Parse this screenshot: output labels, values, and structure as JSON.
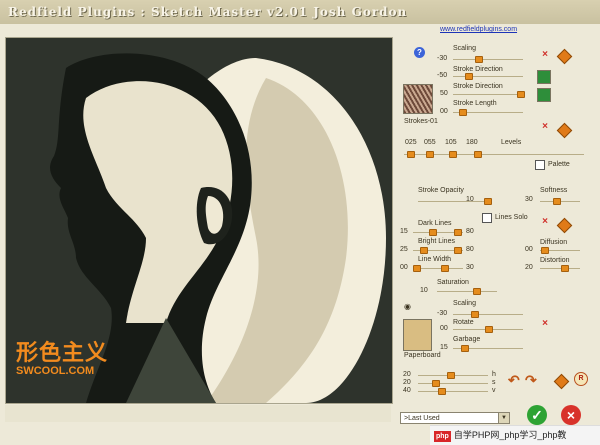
{
  "window": {
    "title": "Redfield Plugins : Sketch Master v2.01    Josh Gordon",
    "url": "www.redfieldplugins.com"
  },
  "preview": {
    "watermark_cn": "形色主义",
    "watermark_site": "SWCOOL.COM"
  },
  "panel": {
    "help_icon": "?",
    "scaling_label": "Scaling",
    "scaling_value": "-30",
    "stroke_direction_label": "Stroke Direction",
    "stroke_direction_value": "-50",
    "stroke_direction2_label": "Stroke Direction",
    "stroke_direction2_value": "50",
    "stroke_length_label": "Stroke Length",
    "stroke_length_value": "00",
    "strokes_preset": "Strokes-01",
    "levels_label": "Levels",
    "levels_values": [
      "025",
      "055",
      "105",
      "180"
    ],
    "palette_label": "Palette",
    "stroke_opacity_label": "Stroke Opacity",
    "stroke_opacity_value": "10",
    "softness_label": "Softness",
    "softness_value": "30",
    "dark_lines_label": "Dark Lines",
    "dark_lines_min": "15",
    "dark_lines_max": "80",
    "lines_solo_label": "Lines Solo",
    "bright_lines_label": "Bright Lines",
    "bright_lines_min": "25",
    "bright_lines_max": "80",
    "diffusion_label": "Diffusion",
    "diffusion_value": "00",
    "line_width_label": "Line Width",
    "line_width_min": "00",
    "line_width_max": "30",
    "distortion_label": "Distortion",
    "distortion_value": "20",
    "saturation_label": "Saturation",
    "saturation_value": "10",
    "paper_scaling_label": "Scaling",
    "paper_scaling_value": "-30",
    "rotate_label": "Rotate",
    "rotate_value": "00",
    "garbage_label": "Garbage",
    "garbage_value": "15",
    "paperboard_label": "Paperboard",
    "h_value": "20",
    "s_value": "20",
    "v_value": "40",
    "h_label": "h",
    "s_label": "s",
    "v_label": "v",
    "reset_label": "R",
    "preset_value": ">Last Used"
  },
  "footer_watermark": {
    "badge": "php",
    "text": "自学PHP网_php学习_php教"
  },
  "colors": {
    "accent_orange": "#e58c1d",
    "close_red": "#d0302a",
    "ok_green": "#2ea334"
  }
}
